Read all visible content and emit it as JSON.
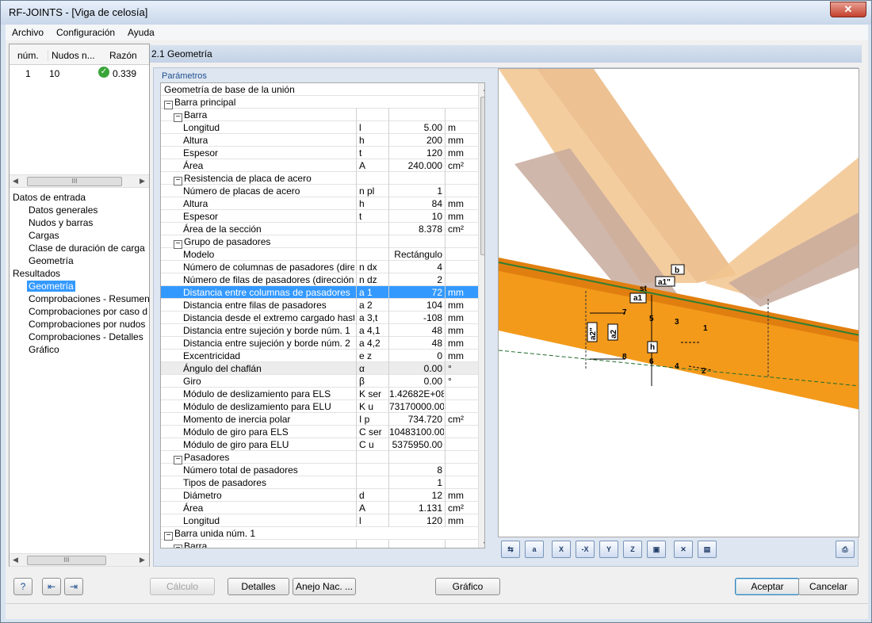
{
  "window": {
    "title": "RF-JOINTS - [Viga de celosía]",
    "close": "✕"
  },
  "menu": [
    "Archivo",
    "Configuración",
    "Ayuda"
  ],
  "cases_table": {
    "headers": [
      "núm.",
      "Nudos n...",
      "Razón"
    ],
    "row": {
      "num": "1",
      "nodes": "10",
      "ratio": "0.339"
    }
  },
  "nav": {
    "input_title": "Datos de entrada",
    "input_items": [
      "Datos generales",
      "Nudos y barras",
      "Cargas",
      "Clase de duración de carga y se",
      "Geometría"
    ],
    "results_title": "Resultados",
    "results_items": [
      "Geometría",
      "Comprobaciones - Resumen",
      "Comprobaciones por caso de ca",
      "Comprobaciones por nudos",
      "Comprobaciones - Detalles",
      "Gráfico"
    ]
  },
  "section_title": "2.1 Geometría",
  "params_label": "Parámetros",
  "rows": [
    {
      "label": "Geometría de base de la unión",
      "level": 0,
      "tree": "",
      "sym": "",
      "val": "",
      "unit": ""
    },
    {
      "label": "Barra principal",
      "level": 0,
      "tree": "⊟",
      "sym": "",
      "val": "",
      "unit": ""
    },
    {
      "label": "Barra",
      "level": 1,
      "tree": "⊟",
      "sym": "",
      "val": "",
      "unit": ""
    },
    {
      "label": "Longitud",
      "level": 2,
      "tree": "",
      "sym": "l",
      "val": "5.00",
      "unit": "m"
    },
    {
      "label": "Altura",
      "level": 2,
      "tree": "",
      "sym": "h",
      "val": "200",
      "unit": "mm"
    },
    {
      "label": "Espesor",
      "level": 2,
      "tree": "",
      "sym": "t",
      "val": "120",
      "unit": "mm"
    },
    {
      "label": "Área",
      "level": 2,
      "tree": "",
      "sym": "A",
      "val": "240.000",
      "unit": "cm²"
    },
    {
      "label": "Resistencia de placa de acero",
      "level": 1,
      "tree": "⊟",
      "sym": "",
      "val": "",
      "unit": ""
    },
    {
      "label": "Número de placas de acero",
      "level": 2,
      "tree": "",
      "sym": "n pl",
      "val": "1",
      "unit": ""
    },
    {
      "label": "Altura",
      "level": 2,
      "tree": "",
      "sym": "h",
      "val": "84",
      "unit": "mm"
    },
    {
      "label": "Espesor",
      "level": 2,
      "tree": "",
      "sym": "t",
      "val": "10",
      "unit": "mm"
    },
    {
      "label": "Área de la sección",
      "level": 2,
      "tree": "",
      "sym": "",
      "val": "8.378",
      "unit": "cm²"
    },
    {
      "label": "Grupo de pasadores",
      "level": 1,
      "tree": "⊟",
      "sym": "",
      "val": "",
      "unit": ""
    },
    {
      "label": "Modelo",
      "level": 2,
      "tree": "",
      "sym": "",
      "val": "Rectángulo",
      "unit": ""
    },
    {
      "label": "Número de columnas de pasadores (direcc",
      "level": 2,
      "tree": "",
      "sym": "n dx",
      "val": "4",
      "unit": ""
    },
    {
      "label": "Número de filas de pasadores (dirección z)",
      "level": 2,
      "tree": "",
      "sym": "n dz",
      "val": "2",
      "unit": ""
    },
    {
      "label": "Distancia entre columnas de pasadores",
      "level": 2,
      "tree": "",
      "sym": "a 1",
      "val": "72",
      "unit": "mm",
      "hl": true
    },
    {
      "label": "Distancia entre filas de pasadores",
      "level": 2,
      "tree": "",
      "sym": "a 2",
      "val": "104",
      "unit": "mm"
    },
    {
      "label": "Distancia desde el extremo cargado hasta",
      "level": 2,
      "tree": "",
      "sym": "a 3,t",
      "val": "-108",
      "unit": "mm"
    },
    {
      "label": "Distancia entre sujeción y borde núm. 1",
      "level": 2,
      "tree": "",
      "sym": "a 4,1",
      "val": "48",
      "unit": "mm"
    },
    {
      "label": "Distancia entre sujeción y borde núm. 2",
      "level": 2,
      "tree": "",
      "sym": "a 4,2",
      "val": "48",
      "unit": "mm"
    },
    {
      "label": "Excentricidad",
      "level": 2,
      "tree": "",
      "sym": "e z",
      "val": "0",
      "unit": "mm"
    },
    {
      "label": "Ángulo del chaflán",
      "level": 2,
      "tree": "",
      "sym": "α",
      "val": "0.00",
      "unit": "°",
      "gray": true
    },
    {
      "label": "Giro",
      "level": 2,
      "tree": "",
      "sym": "β",
      "val": "0.00",
      "unit": "°"
    },
    {
      "label": "Módulo de deslizamiento para ELS",
      "level": 2,
      "tree": "",
      "sym": "K ser",
      "val": "1.42682E+08",
      "unit": ""
    },
    {
      "label": "Módulo de deslizamiento para ELU",
      "level": 2,
      "tree": "",
      "sym": "K u",
      "val": "73170000.00",
      "unit": ""
    },
    {
      "label": "Momento de inercia polar",
      "level": 2,
      "tree": "",
      "sym": "I p",
      "val": "734.720",
      "unit": "cm²"
    },
    {
      "label": "Módulo de giro para ELS",
      "level": 2,
      "tree": "",
      "sym": "C ser",
      "val": "10483100.00",
      "unit": ""
    },
    {
      "label": "Módulo de giro para ELU",
      "level": 2,
      "tree": "",
      "sym": "C u",
      "val": "5375950.00",
      "unit": ""
    },
    {
      "label": "Pasadores",
      "level": 1,
      "tree": "⊟",
      "sym": "",
      "val": "",
      "unit": ""
    },
    {
      "label": "Número total de pasadores",
      "level": 2,
      "tree": "",
      "sym": "",
      "val": "8",
      "unit": ""
    },
    {
      "label": "Tipos de pasadores",
      "level": 2,
      "tree": "",
      "sym": "",
      "val": "1",
      "unit": ""
    },
    {
      "label": "Diámetro",
      "level": 2,
      "tree": "",
      "sym": "d",
      "val": "12",
      "unit": "mm"
    },
    {
      "label": "Área",
      "level": 2,
      "tree": "",
      "sym": "A",
      "val": "1.131",
      "unit": "cm²"
    },
    {
      "label": "Longitud",
      "level": 2,
      "tree": "",
      "sym": "l",
      "val": "120",
      "unit": "mm"
    },
    {
      "label": "Barra unida núm. 1",
      "level": 0,
      "tree": "⊟",
      "sym": "",
      "val": "",
      "unit": ""
    },
    {
      "label": "Barra",
      "level": 1,
      "tree": "⊟",
      "sym": "",
      "val": "",
      "unit": ""
    }
  ],
  "drawing": {
    "labels": [
      "b",
      "a1\"",
      "a1",
      "st",
      "a2\"",
      "a2",
      "h"
    ],
    "node_numbers": [
      "1",
      "2",
      "3",
      "4",
      "5",
      "6",
      "7",
      "8"
    ]
  },
  "view_tools": [
    "view-member-x-icon",
    "view-member-a-icon",
    "view-x-icon",
    "view-minus-x-icon",
    "view-y-icon",
    "view-z-icon",
    "view-iso-icon",
    "render-off-icon",
    "render-on-icon",
    "print-icon"
  ],
  "bottom": {
    "calc": "Cálculo",
    "details": "Detalles",
    "annex": "Anejo Nac. ...",
    "graphic": "Gráfico",
    "ok": "Aceptar",
    "cancel": "Cancelar"
  }
}
